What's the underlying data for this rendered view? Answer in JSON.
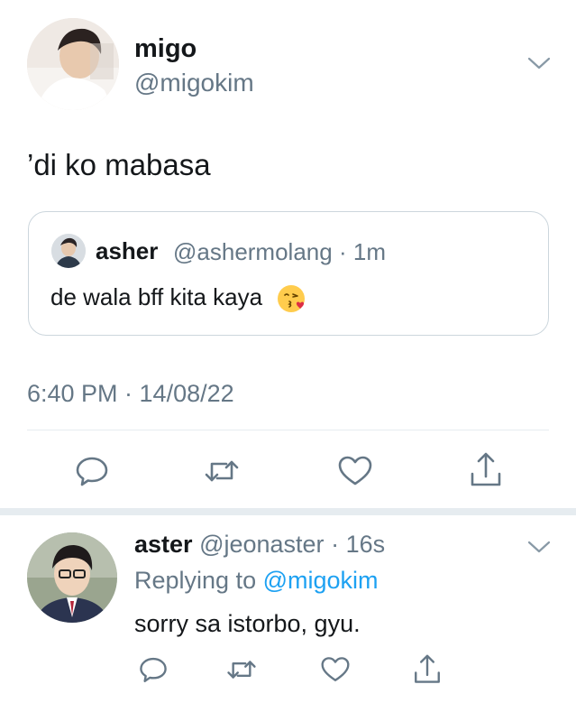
{
  "tweet": {
    "display_name": "migo",
    "handle": "@migokim",
    "text": "’di ko mabasa",
    "timestamp": "6:40 PM · 14/08/22"
  },
  "quoted": {
    "display_name": "asher",
    "handle": "@ashermolang",
    "separator": "·",
    "time": "1m",
    "text": "de wala bff kita kaya",
    "emoji": "😘"
  },
  "reply": {
    "display_name": "aster",
    "handle": "@jeonaster",
    "separator": "·",
    "time": "16s",
    "replying_prefix": "Replying to",
    "replying_handle": "@migokim",
    "text": "sorry sa istorbo, gyu."
  },
  "icons": {
    "reply": "reply-icon",
    "retweet": "retweet-icon",
    "like": "like-icon",
    "share": "share-icon",
    "more": "chevron-down-icon"
  },
  "colors": {
    "text": "#14171a",
    "muted": "#657786",
    "link": "#1da1f2",
    "divider": "#e6ecf0"
  }
}
